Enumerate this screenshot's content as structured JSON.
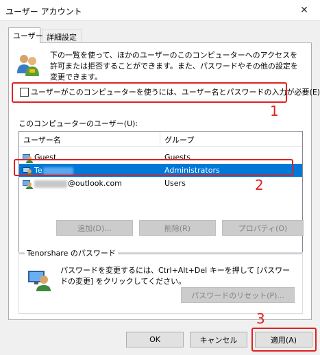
{
  "window": {
    "title": "ユーザー アカウント",
    "close_glyph": "✕"
  },
  "tabs": [
    {
      "label": "ユーザー",
      "active": true
    },
    {
      "label": "詳細設定",
      "active": false
    }
  ],
  "users_tab": {
    "info_text": "下の一覧を使って、ほかのユーザーのこのコンピューターへのアクセスを許可または拒否することができます。また、パスワードやその他の設定を変更できます。",
    "require_password_checkbox": {
      "label": "ユーザーがこのコンピューターを使うには、ユーザー名とパスワードの入力が必要(E)",
      "checked": false
    },
    "users_label": "このコンピューターのユーザー(U):",
    "columns": [
      "ユーザー名",
      "グループ"
    ],
    "rows": [
      {
        "name": "Guest",
        "group": "Guests",
        "selected": false
      },
      {
        "name": "Te",
        "group": "Administrators",
        "selected": true
      },
      {
        "name": "@outlook.com",
        "group": "Users",
        "selected": false
      }
    ],
    "buttons": {
      "add": "追加(D)...",
      "remove": "削除(R)",
      "properties": "プロパティ(O)"
    },
    "password_group": {
      "title": "Tenorshare のパスワード",
      "text": "パスワードを変更するには、Ctrl+Alt+Del キーを押して [パスワードの変更] をクリックしてください。",
      "reset_button": "パスワードのリセット(P)..."
    }
  },
  "footer": {
    "ok": "OK",
    "cancel": "キャンセル",
    "apply": "適用(A)"
  },
  "annotations": [
    {
      "number": "1"
    },
    {
      "number": "2"
    },
    {
      "number": "3"
    }
  ],
  "colors": {
    "selection": "#0078d7",
    "annotation": "#e02020",
    "disabled_text": "#838383"
  },
  "icons": {
    "window_close": "close-icon",
    "users_info": "users-group-icon",
    "user_row": "user-icon",
    "password": "user-password-icon"
  }
}
